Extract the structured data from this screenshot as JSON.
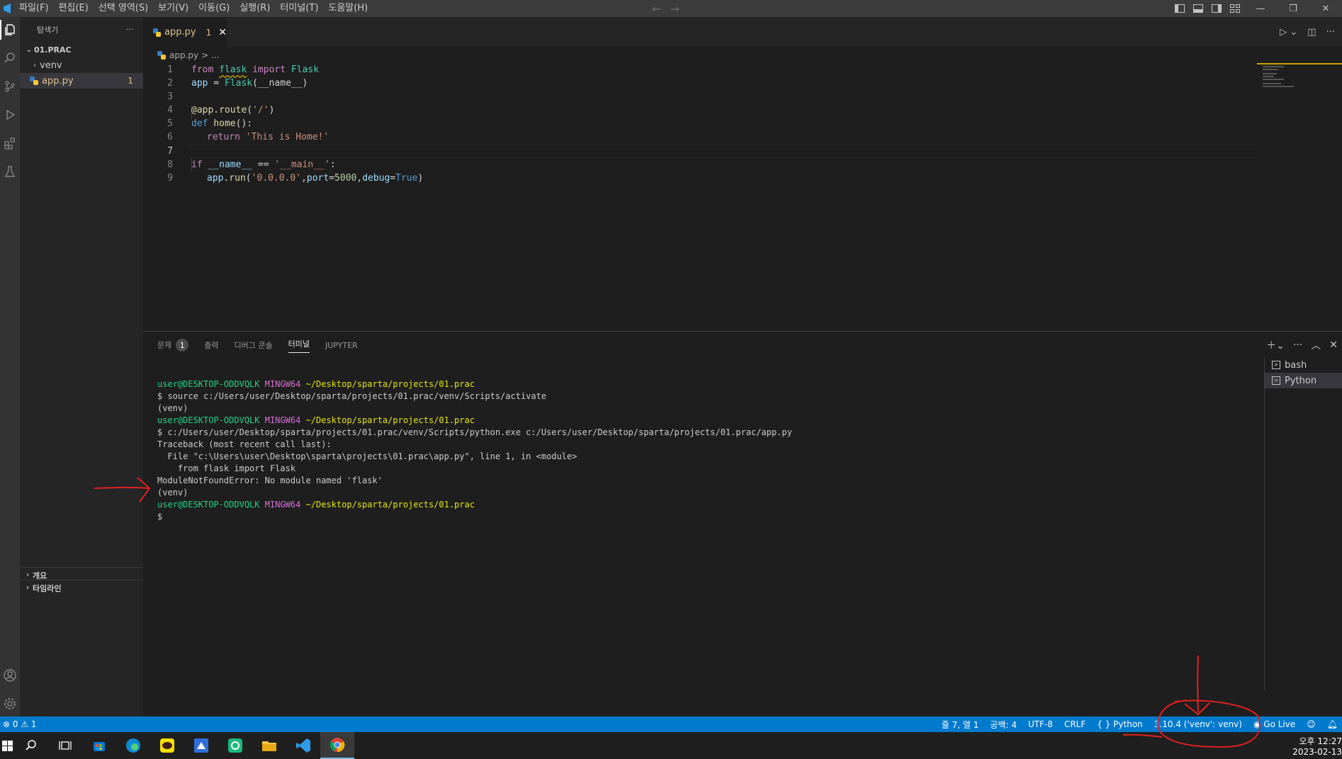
{
  "window": {
    "menu": [
      "파일(F)",
      "편집(E)",
      "선택 영역(S)",
      "보기(V)",
      "이동(G)",
      "실행(R)",
      "터미널(T)",
      "도움말(H)"
    ]
  },
  "sidebar": {
    "title": "탐색기",
    "more": "···",
    "folder": "01.PRAC",
    "items": [
      {
        "label": "venv",
        "type": "folder"
      },
      {
        "label": "app.py",
        "type": "file",
        "badge": "1"
      }
    ],
    "bottom_sections": [
      "개요",
      "타임라인"
    ]
  },
  "editor": {
    "tab": {
      "label": "app.py",
      "badge": "1",
      "close": "✕"
    },
    "breadcrumb": {
      "file": "app.py",
      "rest": "> ..."
    },
    "lines": [
      {
        "n": "1"
      },
      {
        "n": "2"
      },
      {
        "n": "3"
      },
      {
        "n": "4"
      },
      {
        "n": "5"
      },
      {
        "n": "6"
      },
      {
        "n": "7"
      },
      {
        "n": "8"
      },
      {
        "n": "9"
      }
    ],
    "code": {
      "l1_from": "from",
      "l1_mod": "flask",
      "l1_import": "import",
      "l1_cls": "Flask",
      "l2_var": "app",
      "l2_eq": " = ",
      "l2_cls": "Flask",
      "l2_args": "(__name__)",
      "l4_dec": "@app.route",
      "l4_p1": "(",
      "l4_str": "'/'",
      "l4_p2": ")",
      "l5_def": "def",
      "l5_fn": "home",
      "l5_rest": "():",
      "l6_ret": "return",
      "l6_str": "'This is Home!'",
      "l8_if": "if",
      "l8_name": "__name__",
      "l8_eq": " == ",
      "l8_str": "'__main__'",
      "l8_colon": ":",
      "l9_app": "app",
      "l9_run": ".run",
      "l9_p1": "(",
      "l9_str": "'0.0.0.0'",
      "l9_c1": ",",
      "l9_port": "port",
      "l9_eq1": "=",
      "l9_num": "5000",
      "l9_c2": ",",
      "l9_debug": "debug",
      "l9_eq2": "=",
      "l9_true": "True",
      "l9_p2": ")"
    }
  },
  "panel": {
    "tabs": [
      {
        "label": "문제",
        "badge": "1"
      },
      {
        "label": "출력"
      },
      {
        "label": "디버그 콘솔"
      },
      {
        "label": "터미널",
        "active": true
      },
      {
        "label": "JUPYTER"
      }
    ],
    "terminals": [
      "bash",
      "Python"
    ],
    "terminal": {
      "user": "user@DESKTOP-ODDVQLK",
      "host": "MINGW64",
      "path": "~/Desktop/sparta/projects/01.prac",
      "cmd1": "$ source c:/Users/user/Desktop/sparta/projects/01.prac/venv/Scripts/activate",
      "venv": "(venv)",
      "cmd2": "$ c:/Users/user/Desktop/sparta/projects/01.prac/venv/Scripts/python.exe c:/Users/user/Desktop/sparta/projects/01.prac/app.py",
      "tb1": "Traceback (most recent call last):",
      "tb2": "  File \"c:\\Users\\user\\Desktop\\sparta\\projects\\01.prac\\app.py\", line 1, in <module>",
      "tb3": "    from flask import Flask",
      "err": "ModuleNotFoundError: No module named 'flask'",
      "prompt": "$"
    }
  },
  "statusbar": {
    "problems": "⊗ 0 ⚠ 1",
    "position": "줄 7, 열 1",
    "spaces": "공백: 4",
    "encoding": "UTF-8",
    "eol": "CRLF",
    "language": "Python",
    "interpreter": "3.10.4 ('venv': venv)",
    "golive": "Go Live"
  },
  "taskbar": {
    "time": "오후 12:27",
    "date": "2023-02-13"
  },
  "colors": {
    "statusbar": "#007acc",
    "annotation": "#e02020"
  }
}
